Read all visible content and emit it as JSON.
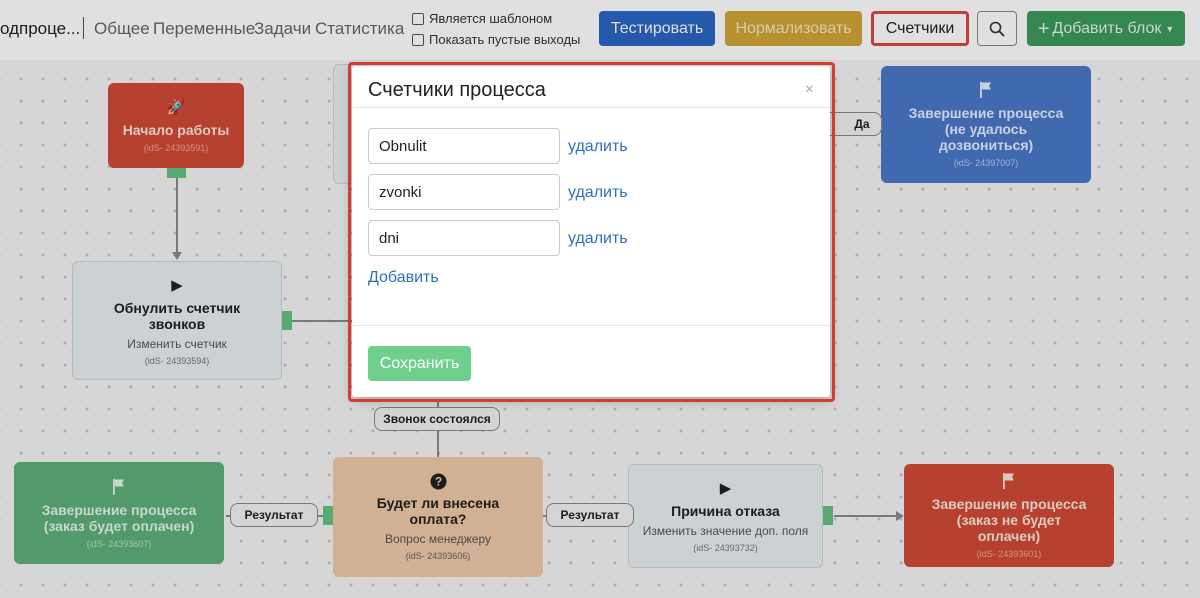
{
  "header": {
    "brand": "одпроце...",
    "nav": [
      "Общее",
      "Переменные",
      "Задачи",
      "Статистика"
    ],
    "checkbox_template": "Является шаблоном",
    "checkbox_empty_outputs": "Показать пустые выходы",
    "btn_test": "Тестировать",
    "btn_normalize": "Нормализовать",
    "btn_counters": "Счетчики",
    "btn_add_block": "Добавить блок",
    "colors": {
      "test": "#2b66c4",
      "normalize": "#d1a536",
      "add": "#3d9a5e",
      "highlight": "#e0453d"
    }
  },
  "nodes": {
    "start": {
      "title": "Начало работы",
      "ids": "(idS- 24393591)",
      "icon": "rocket-icon"
    },
    "reset": {
      "title": "Обнулить счетчик звонков",
      "subtitle": "Изменить счетчик",
      "ids": "(idS- 24393594)",
      "icon": "play-icon"
    },
    "end_fail": {
      "title": "Завершение процесса (не удалось дозвониться)",
      "ids": "(idS- 24397007)",
      "icon": "flag-icon"
    },
    "end_paid": {
      "title": "Завершение процесса (заказ будет оплачен)",
      "ids": "(idS- 24393607)",
      "icon": "flag-icon"
    },
    "question": {
      "title": "Будет ли внесена оплата?",
      "subtitle": "Вопрос менеджеру",
      "ids": "(idS- 24393606)",
      "icon": "question-icon"
    },
    "reason": {
      "title": "Причина отказа",
      "subtitle": "Изменить значение доп. поля",
      "ids": "(idS- 24393732)",
      "icon": "play-icon"
    },
    "end_unpaid": {
      "title": "Завершение процесса (заказ не будет оплачен)",
      "ids": "(idS- 24393601)",
      "icon": "flag-icon"
    }
  },
  "edge_labels": {
    "yes": "Да",
    "call_happened": "Звонок состоялся",
    "result_left": "Результат",
    "result_right": "Результат"
  },
  "modal": {
    "title": "Счетчики процесса",
    "close": "×",
    "counters": [
      {
        "value": "Obnulit",
        "delete": "удалить"
      },
      {
        "value": "zvonki",
        "delete": "удалить"
      },
      {
        "value": "dni",
        "delete": "удалить"
      }
    ],
    "add_label": "Добавить",
    "save_label": "Сохранить"
  }
}
